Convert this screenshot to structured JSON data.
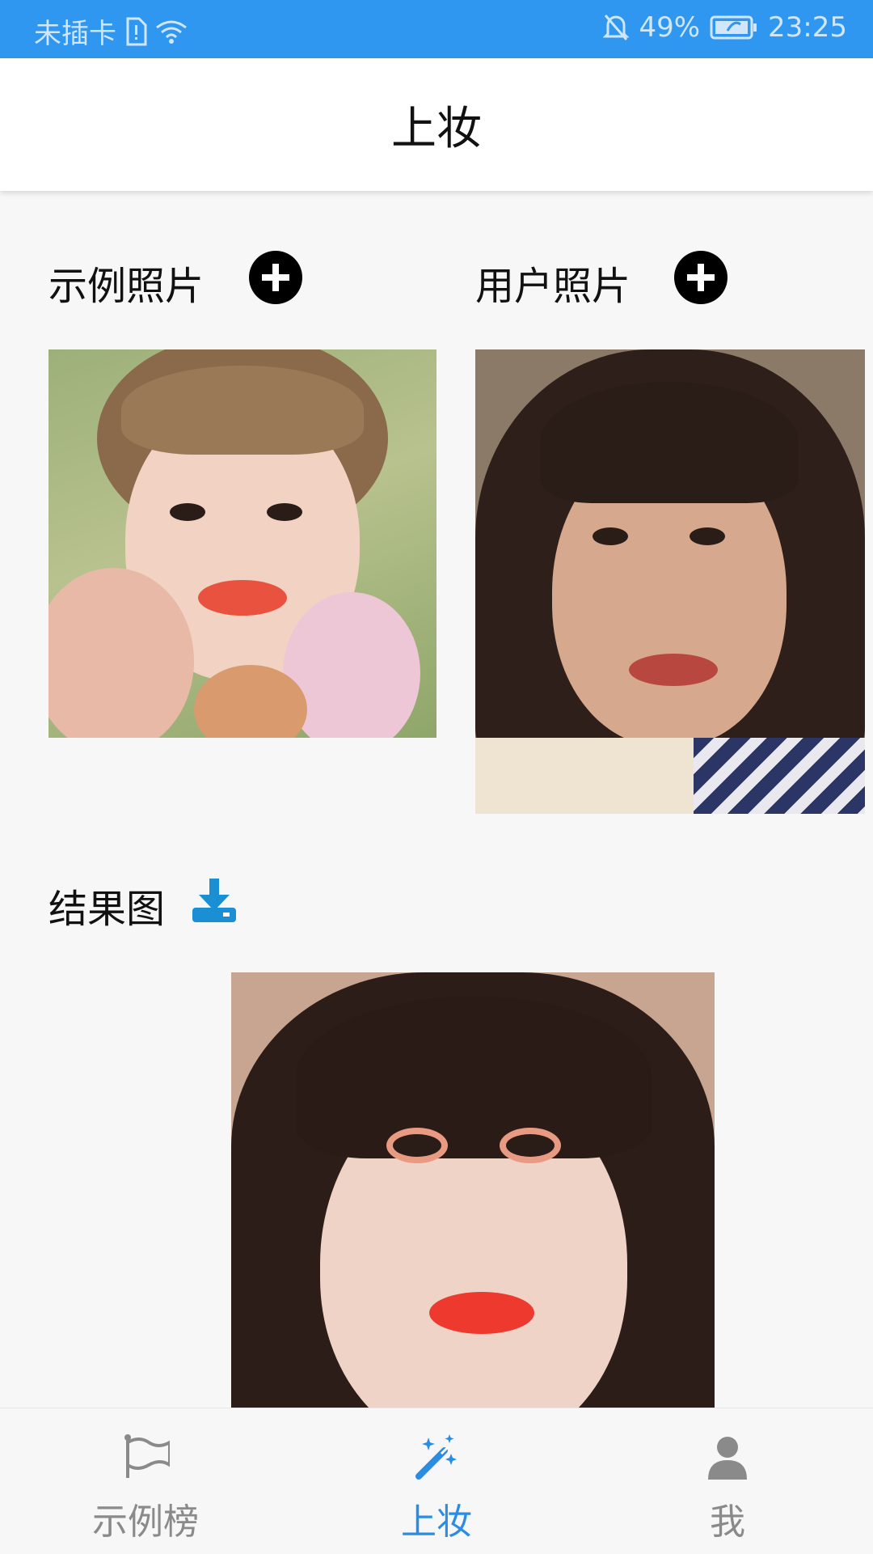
{
  "status_bar": {
    "carrier": "未插卡",
    "battery_percent": "49%",
    "time": "23:25",
    "icons": [
      "sim-alert-icon",
      "wifi-icon",
      "mute-bell-icon",
      "battery-icon"
    ]
  },
  "app_bar": {
    "title": "上妆"
  },
  "example_section": {
    "label": "示例照片",
    "add_icon": "add-circle-icon"
  },
  "user_section": {
    "label": "用户照片",
    "add_icon": "add-circle-icon"
  },
  "result_section": {
    "label": "结果图",
    "download_icon": "download-icon"
  },
  "bottom_nav": {
    "items": [
      {
        "label": "示例榜",
        "icon": "flag-icon",
        "active": false
      },
      {
        "label": "上妆",
        "icon": "magic-wand-icon",
        "active": true
      },
      {
        "label": "我",
        "icon": "user-icon",
        "active": false
      }
    ]
  },
  "colors": {
    "status_bar": "#2f97f0",
    "accent": "#2a8ce3",
    "download_icon": "#1a8fd4",
    "inactive_nav": "#8a8a8a"
  }
}
